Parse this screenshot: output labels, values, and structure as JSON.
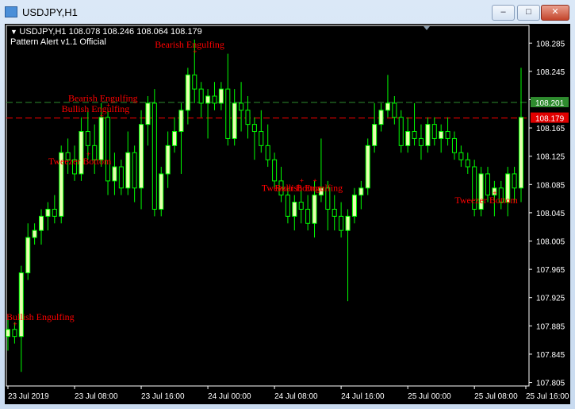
{
  "window": {
    "title": "USDJPY,H1"
  },
  "buttons": {
    "minimize": "–",
    "maximize": "□",
    "close": "✕"
  },
  "chart_header": {
    "symbol_line": "USDJPY,H1  108.078 108.246 108.064 108.179",
    "indicator_line": "Pattern Alert v1.1 Official"
  },
  "colors": {
    "background": "#000000",
    "bull": "#e8ffb0",
    "bear": "#000000",
    "wick": "#00ff00",
    "pattern_label": "#ff0000",
    "bid_line": "#ff0000",
    "ask_line": "#2e8b2e",
    "axis": "#ffffff"
  },
  "chart_data": {
    "type": "candlestick",
    "symbol": "USDJPY",
    "timeframe": "H1",
    "last_ohlc": {
      "open": 108.078,
      "high": 108.246,
      "low": 108.064,
      "close": 108.179
    },
    "ylim": [
      107.8,
      108.31
    ],
    "y_ticks": [
      "108.285",
      "108.245",
      "108.205",
      "108.165",
      "108.125",
      "108.085",
      "108.045",
      "108.005",
      "107.965",
      "107.925",
      "107.885",
      "107.845",
      "107.805"
    ],
    "x_ticks": [
      "23 Jul 2019",
      "23 Jul 08:00",
      "23 Jul 16:00",
      "24 Jul 00:00",
      "24 Jul 08:00",
      "24 Jul 16:00",
      "25 Jul 00:00",
      "25 Jul 08:00",
      "25 Jul 16:00"
    ],
    "price_labels": {
      "ask": "108.201",
      "bid": "108.179"
    },
    "candles": [
      [
        107.87,
        107.9,
        107.85,
        107.88
      ],
      [
        107.88,
        107.89,
        107.86,
        107.87
      ],
      [
        107.87,
        107.97,
        107.82,
        107.96
      ],
      [
        107.96,
        108.03,
        107.95,
        108.01
      ],
      [
        108.01,
        108.03,
        108.0,
        108.02
      ],
      [
        108.02,
        108.05,
        108.0,
        108.04
      ],
      [
        108.04,
        108.06,
        108.02,
        108.05
      ],
      [
        108.05,
        108.07,
        108.03,
        108.04
      ],
      [
        108.04,
        108.14,
        108.03,
        108.13
      ],
      [
        108.13,
        108.15,
        108.1,
        108.12
      ],
      [
        108.12,
        108.14,
        108.09,
        108.1
      ],
      [
        108.1,
        108.18,
        108.09,
        108.16
      ],
      [
        108.16,
        108.19,
        108.12,
        108.14
      ],
      [
        108.14,
        108.17,
        108.1,
        108.12
      ],
      [
        108.12,
        108.2,
        108.11,
        108.18
      ],
      [
        108.18,
        108.19,
        108.07,
        108.09
      ],
      [
        108.09,
        108.13,
        108.07,
        108.11
      ],
      [
        108.11,
        108.12,
        108.07,
        108.08
      ],
      [
        108.08,
        108.16,
        108.07,
        108.13
      ],
      [
        108.13,
        108.14,
        108.06,
        108.08
      ],
      [
        108.08,
        108.19,
        108.05,
        108.17
      ],
      [
        108.17,
        108.21,
        108.14,
        108.2
      ],
      [
        108.2,
        108.22,
        108.04,
        108.05
      ],
      [
        108.05,
        108.11,
        108.04,
        108.1
      ],
      [
        108.1,
        108.16,
        108.08,
        108.14
      ],
      [
        108.14,
        108.18,
        108.13,
        108.16
      ],
      [
        108.16,
        108.2,
        108.1,
        108.19
      ],
      [
        108.19,
        108.25,
        108.17,
        108.24
      ],
      [
        108.24,
        108.29,
        108.2,
        108.22
      ],
      [
        108.22,
        108.23,
        108.18,
        108.2
      ],
      [
        108.2,
        108.22,
        108.15,
        108.21
      ],
      [
        108.21,
        108.23,
        108.19,
        108.2
      ],
      [
        108.2,
        108.23,
        108.19,
        108.22
      ],
      [
        108.22,
        108.27,
        108.14,
        108.15
      ],
      [
        108.15,
        108.22,
        108.14,
        108.2
      ],
      [
        108.2,
        108.23,
        108.16,
        108.19
      ],
      [
        108.19,
        108.21,
        108.15,
        108.17
      ],
      [
        108.17,
        108.18,
        108.12,
        108.16
      ],
      [
        108.16,
        108.19,
        108.13,
        108.14
      ],
      [
        108.14,
        108.17,
        108.11,
        108.12
      ],
      [
        108.12,
        108.13,
        108.08,
        108.09
      ],
      [
        108.09,
        108.11,
        108.06,
        108.07
      ],
      [
        108.07,
        108.08,
        108.03,
        108.04
      ],
      [
        108.04,
        108.07,
        108.02,
        108.06
      ],
      [
        108.06,
        108.08,
        108.03,
        108.05
      ],
      [
        108.05,
        108.07,
        108.02,
        108.03
      ],
      [
        108.03,
        108.09,
        108.01,
        108.07
      ],
      [
        108.07,
        108.15,
        108.06,
        108.08
      ],
      [
        108.08,
        108.09,
        108.02,
        108.05
      ],
      [
        108.05,
        108.07,
        108.02,
        108.04
      ],
      [
        108.04,
        108.06,
        108.01,
        108.02
      ],
      [
        108.02,
        108.05,
        107.92,
        108.04
      ],
      [
        108.04,
        108.08,
        108.03,
        108.07
      ],
      [
        108.07,
        108.09,
        108.05,
        108.08
      ],
      [
        108.08,
        108.15,
        108.07,
        108.14
      ],
      [
        108.14,
        108.2,
        108.13,
        108.17
      ],
      [
        108.17,
        108.2,
        108.16,
        108.19
      ],
      [
        108.19,
        108.24,
        108.18,
        108.2
      ],
      [
        108.2,
        108.21,
        108.17,
        108.18
      ],
      [
        108.18,
        108.19,
        108.13,
        108.14
      ],
      [
        108.14,
        108.18,
        108.13,
        108.16
      ],
      [
        108.16,
        108.2,
        108.14,
        108.15
      ],
      [
        108.15,
        108.17,
        108.12,
        108.14
      ],
      [
        108.14,
        108.18,
        108.13,
        108.17
      ],
      [
        108.17,
        108.18,
        108.14,
        108.15
      ],
      [
        108.15,
        108.17,
        108.13,
        108.16
      ],
      [
        108.16,
        108.18,
        108.14,
        108.15
      ],
      [
        108.15,
        108.16,
        108.12,
        108.13
      ],
      [
        108.13,
        108.14,
        108.11,
        108.12
      ],
      [
        108.12,
        108.13,
        108.1,
        108.11
      ],
      [
        108.11,
        108.12,
        108.04,
        108.05
      ],
      [
        108.05,
        108.11,
        108.04,
        108.1
      ],
      [
        108.1,
        108.11,
        108.06,
        108.07
      ],
      [
        108.07,
        108.09,
        108.04,
        108.08
      ],
      [
        108.08,
        108.09,
        108.05,
        108.06
      ],
      [
        108.06,
        108.11,
        108.04,
        108.1
      ],
      [
        108.1,
        108.11,
        108.06,
        108.08
      ],
      [
        108.08,
        108.25,
        108.06,
        108.18
      ]
    ],
    "annotations": [
      {
        "text": "Bearish Engulfing",
        "candle": 28,
        "price": 108.283,
        "position": "above"
      },
      {
        "text": "Bearish Engulfing",
        "candle": 15,
        "price": 108.207,
        "position": "above"
      },
      {
        "text": "Bullish Engulfing",
        "candle": 14,
        "price": 108.192,
        "position": "above"
      },
      {
        "text": "Tweezer Bottom",
        "candle": 12,
        "price": 108.118,
        "position": "below"
      },
      {
        "text": "Tweezer Bottom",
        "candle": 44,
        "price": 108.08,
        "position": "below"
      },
      {
        "text": "Bullish Engulfing",
        "candle": 46,
        "price": 108.08,
        "position": "below"
      },
      {
        "text": "Tweezer Bottom",
        "candle": 73,
        "price": 108.063,
        "position": "below"
      },
      {
        "text": "Bullish Engulfing",
        "candle": 1,
        "price": 107.898,
        "position": "left"
      }
    ]
  }
}
